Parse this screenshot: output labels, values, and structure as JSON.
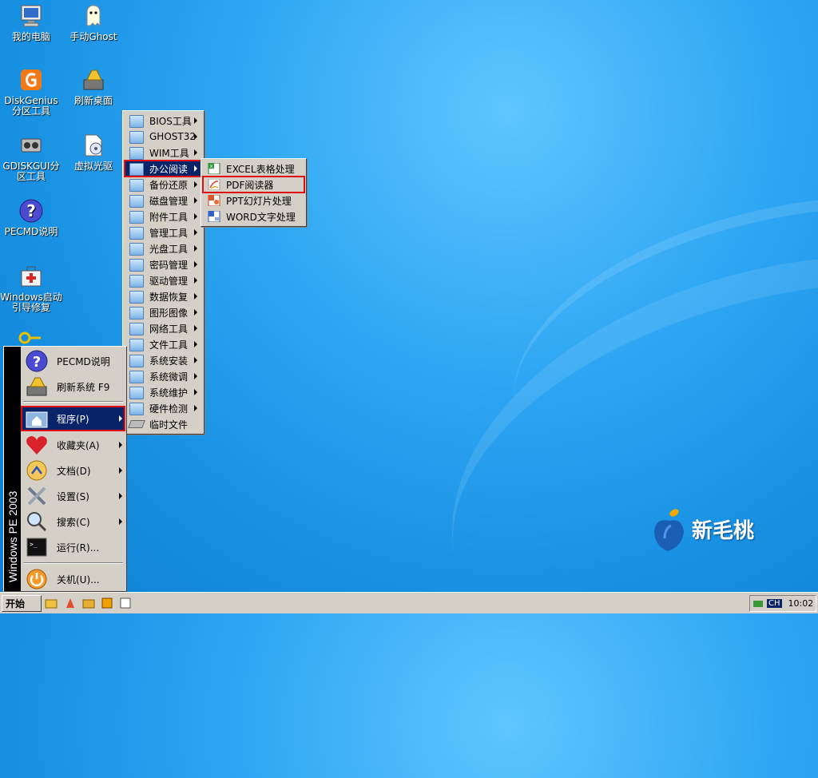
{
  "desktop": {
    "icons": [
      {
        "label": "我的电脑",
        "icon": "computer-icon"
      },
      {
        "label": "手动Ghost",
        "icon": "ghost-icon"
      },
      {
        "label": "DiskGenius分区工具",
        "icon": "diskgenius-icon"
      },
      {
        "label": "刷新桌面",
        "icon": "refresh-icon"
      },
      {
        "label": "GDISKGUI分区工具",
        "icon": "gdisk-icon"
      },
      {
        "label": "虚拟光驱",
        "icon": "virtual-drive-icon"
      },
      {
        "label": "PECMD说明",
        "icon": "help-icon"
      },
      {
        "label": "Windows启动引导修复",
        "icon": "repair-icon"
      }
    ],
    "brand": "新毛桃"
  },
  "start_menu": {
    "sidebar_text": "Windows PE 2003",
    "items": [
      {
        "label": "PECMD说明",
        "icon": "help-icon"
      },
      {
        "label": "刷新系统 F9",
        "icon": "refresh-icon"
      },
      {
        "label": "程序(P)",
        "icon": "programs-icon"
      },
      {
        "label": "收藏夹(A)",
        "icon": "heart-icon"
      },
      {
        "label": "文档(D)",
        "icon": "documents-icon"
      },
      {
        "label": "设置(S)",
        "icon": "settings-icon"
      },
      {
        "label": "搜索(C)",
        "icon": "search-icon"
      },
      {
        "label": "运行(R)...",
        "icon": "run-icon"
      },
      {
        "label": "关机(U)...",
        "icon": "shutdown-icon"
      }
    ]
  },
  "programs_menu": {
    "items": [
      {
        "label": "BIOS工具"
      },
      {
        "label": "GHOST32"
      },
      {
        "label": "WIM工具"
      },
      {
        "label": "办公阅读"
      },
      {
        "label": "备份还原"
      },
      {
        "label": "磁盘管理"
      },
      {
        "label": "附件工具"
      },
      {
        "label": "管理工具"
      },
      {
        "label": "光盘工具"
      },
      {
        "label": "密码管理"
      },
      {
        "label": "驱动管理"
      },
      {
        "label": "数据恢复"
      },
      {
        "label": "图形图像"
      },
      {
        "label": "网络工具"
      },
      {
        "label": "文件工具"
      },
      {
        "label": "系统安装"
      },
      {
        "label": "系统微调"
      },
      {
        "label": "系统维护"
      },
      {
        "label": "硬件检测"
      },
      {
        "label": "临时文件"
      }
    ]
  },
  "office_menu": {
    "items": [
      {
        "label": "EXCEL表格处理",
        "icon": "excel-icon"
      },
      {
        "label": "PDF阅读器",
        "icon": "pdf-icon"
      },
      {
        "label": "PPT幻灯片处理",
        "icon": "ppt-icon"
      },
      {
        "label": "WORD文字处理",
        "icon": "word-icon"
      }
    ]
  },
  "taskbar": {
    "start_label": "开始",
    "lang": "CH",
    "clock": "10:02"
  }
}
